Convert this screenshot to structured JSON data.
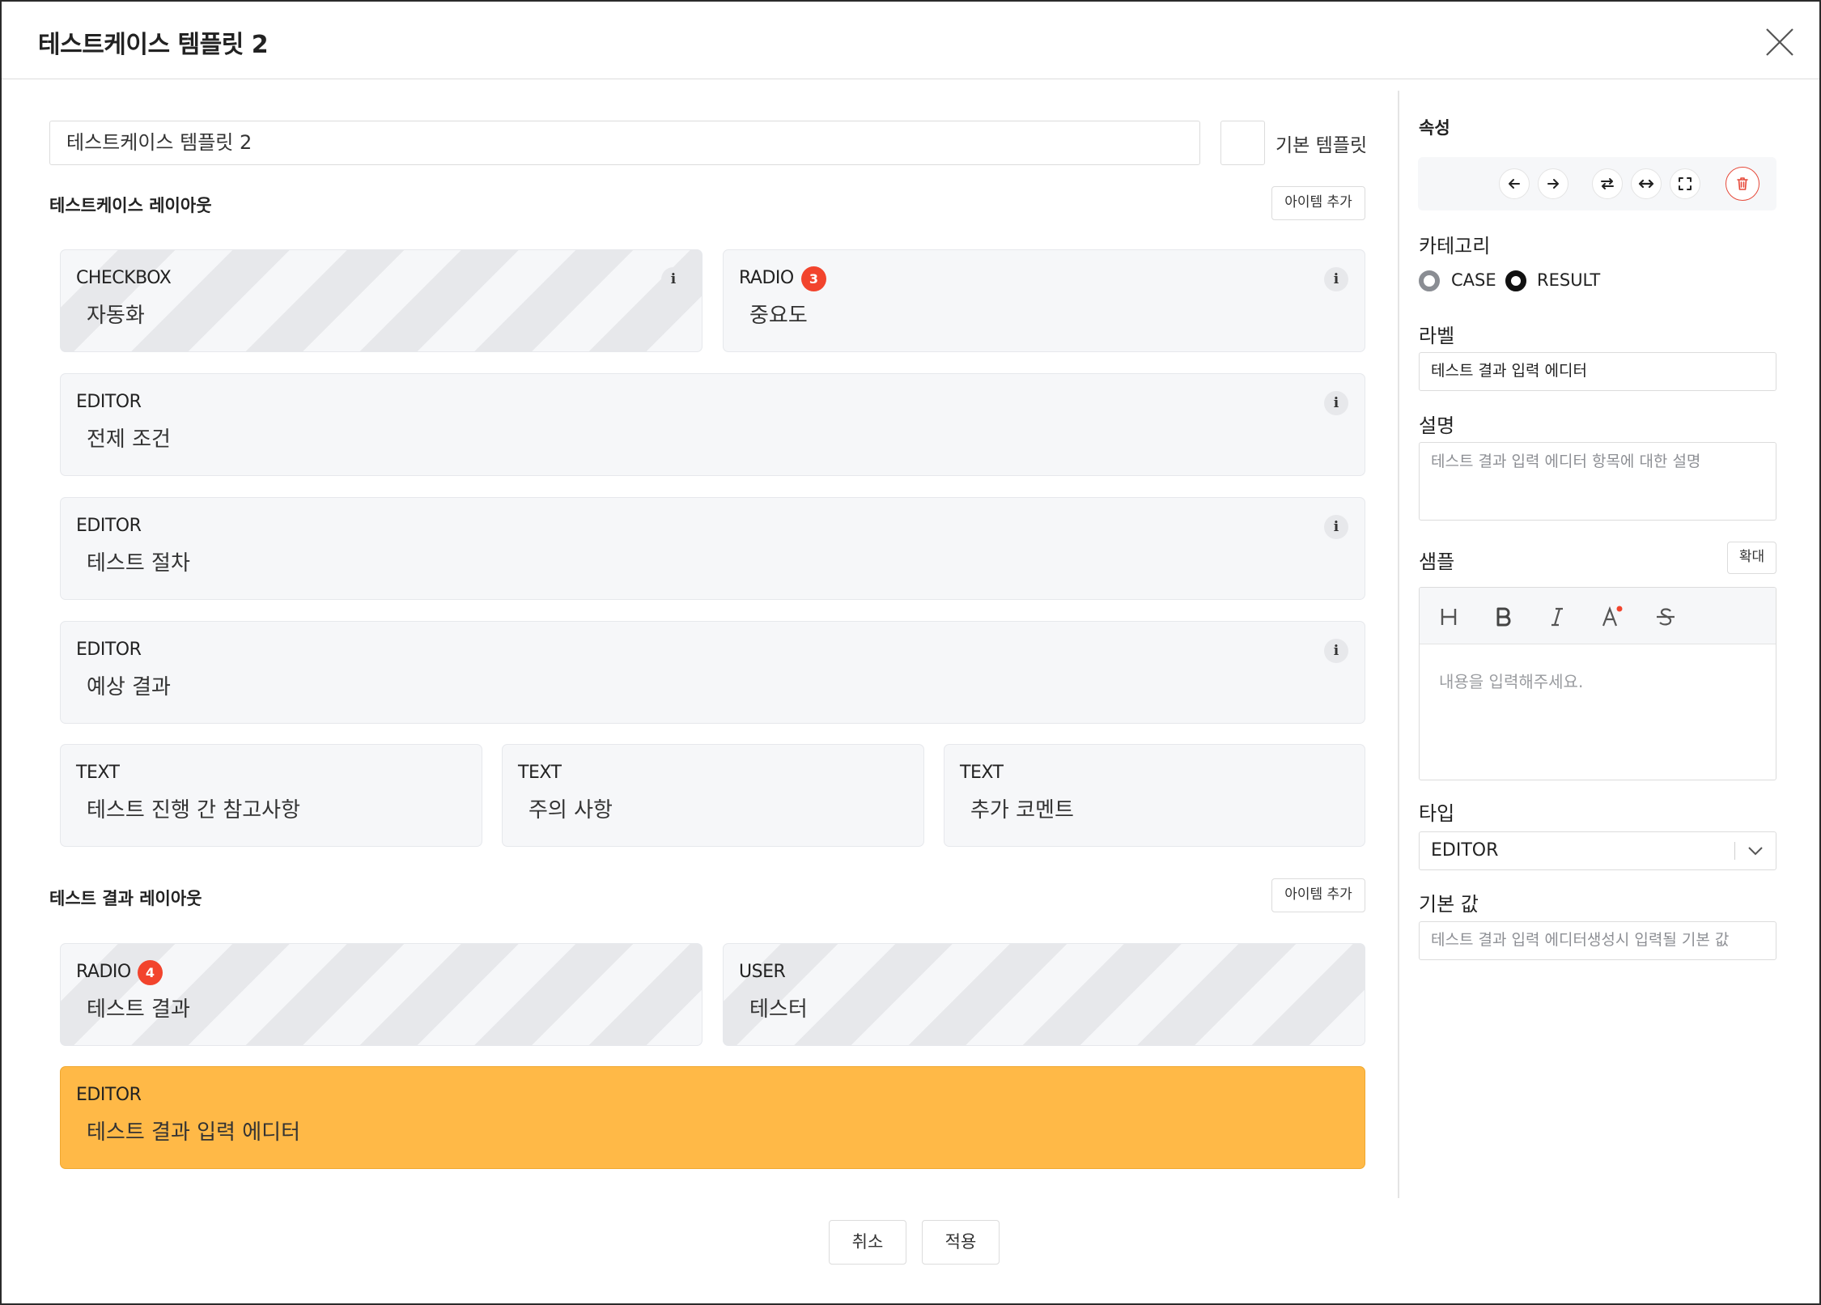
{
  "dialog": {
    "title": "테스트케이스 템플릿 2"
  },
  "template": {
    "name_value": "테스트케이스 템플릿 2",
    "default_label": "기본 템플릿"
  },
  "case_layout": {
    "title": "테스트케이스 레이아웃",
    "add_button": "아이템 추가",
    "items": [
      {
        "type": "CHECKBOX",
        "label": "자동화",
        "info": "i"
      },
      {
        "type": "RADIO",
        "label": "중요도",
        "badge": "3",
        "info": "i"
      },
      {
        "type": "EDITOR",
        "label": "전제 조건",
        "info": "i"
      },
      {
        "type": "EDITOR",
        "label": "테스트 절차",
        "info": "i"
      },
      {
        "type": "EDITOR",
        "label": "예상 결과",
        "info": "i"
      },
      {
        "type": "TEXT",
        "label": "테스트 진행 간 참고사항"
      },
      {
        "type": "TEXT",
        "label": "주의 사항"
      },
      {
        "type": "TEXT",
        "label": "추가 코멘트"
      }
    ]
  },
  "result_layout": {
    "title": "테스트 결과 레이아웃",
    "add_button": "아이템 추가",
    "items": [
      {
        "type": "RADIO",
        "label": "테스트 결과",
        "badge": "4"
      },
      {
        "type": "USER",
        "label": "테스터"
      },
      {
        "type": "EDITOR",
        "label": "테스트 결과 입력 에디터",
        "selected": true
      }
    ]
  },
  "footer": {
    "cancel": "취소",
    "apply": "적용"
  },
  "properties": {
    "title": "속성",
    "toolbar_icons": [
      "arrow-left-icon",
      "arrow-right-icon",
      "swap-icon",
      "expand-horizontal-icon",
      "fullscreen-icon",
      "trash-icon"
    ],
    "category_label": "카테고리",
    "category_options": [
      "CASE",
      "RESULT"
    ],
    "category_selected": "RESULT",
    "label_label": "라벨",
    "label_value": "테스트 결과 입력 에디터",
    "description_label": "설명",
    "description_placeholder": "테스트 결과 입력 에디터 항목에 대한 설명",
    "sample_label": "샘플",
    "expand_button": "확대",
    "editor_toolbar": [
      "heading-icon",
      "bold-icon",
      "italic-icon",
      "font-color-icon",
      "strikethrough-icon"
    ],
    "editor_placeholder": "내용을 입력해주세요.",
    "type_label": "타입",
    "type_value": "EDITOR",
    "default_value_label": "기본 값",
    "default_value_placeholder": "테스트 결과 입력 에디터생성시 입력될 기본 값"
  },
  "colors": {
    "selected_card": "#ffb947",
    "badge": "#f2442d",
    "card_bg": "#f6f7f9",
    "danger": "#e64a3a"
  }
}
